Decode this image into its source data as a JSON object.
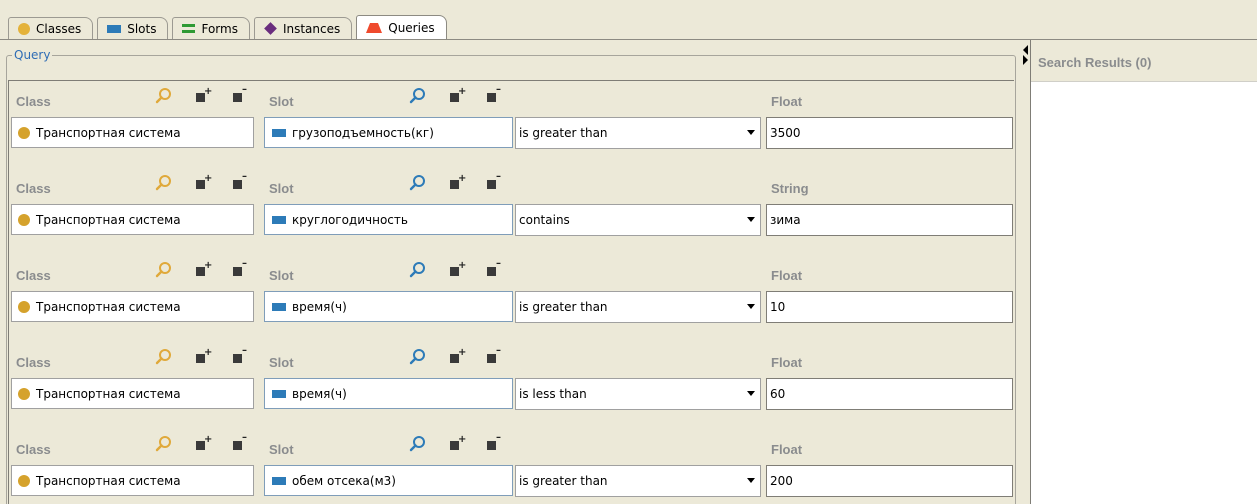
{
  "tabs": [
    {
      "label": "Classes",
      "icon": "class-icon",
      "active": false
    },
    {
      "label": "Slots",
      "icon": "slot-icon",
      "active": false
    },
    {
      "label": "Forms",
      "icon": "form-icon",
      "active": false
    },
    {
      "label": "Instances",
      "icon": "instance-icon",
      "active": false
    },
    {
      "label": "Queries",
      "icon": "query-icon",
      "active": true
    }
  ],
  "query": {
    "legend": "Query",
    "rows": [
      {
        "class_label": "Class",
        "slot_label": "Slot",
        "type_label": "Float",
        "class_value": "Транспортная система",
        "slot_value": "грузоподъемность(кг)",
        "operator": "is greater than",
        "value": "3500"
      },
      {
        "class_label": "Class",
        "slot_label": "Slot",
        "type_label": "String",
        "class_value": "Транспортная система",
        "slot_value": "круглогодичность",
        "operator": "contains",
        "value": "зима"
      },
      {
        "class_label": "Class",
        "slot_label": "Slot",
        "type_label": "Float",
        "class_value": "Транспортная система",
        "slot_value": "время(ч)",
        "operator": "is greater than",
        "value": "10"
      },
      {
        "class_label": "Class",
        "slot_label": "Slot",
        "type_label": "Float",
        "class_value": "Транспортная система",
        "slot_value": "время(ч)",
        "operator": "is less than",
        "value": "60"
      },
      {
        "class_label": "Class",
        "slot_label": "Slot",
        "type_label": "Float",
        "class_value": "Транспортная система",
        "slot_value": "обем отсека(м3)",
        "operator": "is greater than",
        "value": "200"
      }
    ]
  },
  "results": {
    "title": "Search Results (0)"
  },
  "colors": {
    "class_icon": "#d5a22c",
    "slot_icon": "#2d7bb8",
    "form_icon": "#2f9a34",
    "instance_icon": "#6a2e7e",
    "query_icon": "#ef4a2d",
    "legend": "#2f6db5",
    "header_label": "#8a8c8e"
  }
}
